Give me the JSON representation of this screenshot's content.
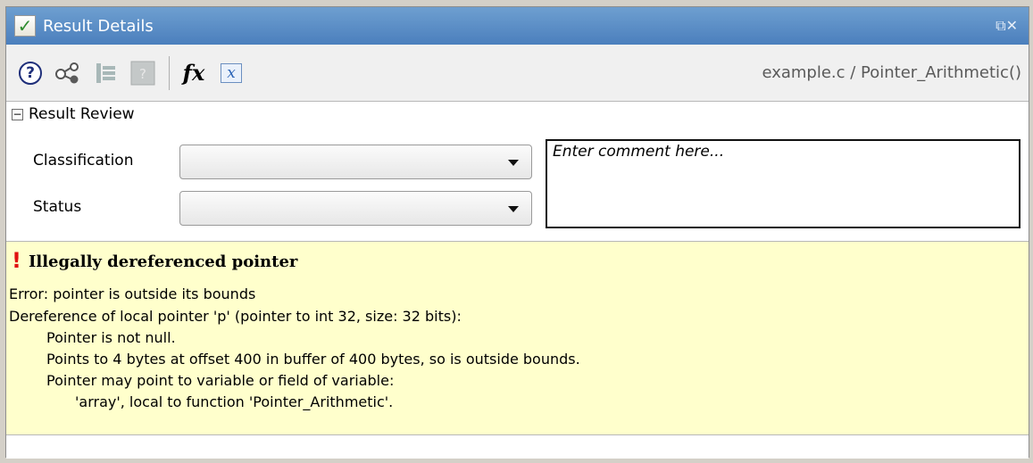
{
  "titlebar": {
    "title": "Result Details",
    "controls": "⧉✕"
  },
  "toolbar": {
    "fx_label": "fx",
    "x_label": "x",
    "breadcrumb": "example.c / Pointer_Arithmetic()"
  },
  "review": {
    "section_label": "Result Review",
    "collapse_glyph": "−",
    "classification_label": "Classification",
    "status_label": "Status",
    "classification_value": "",
    "status_value": "",
    "comment_placeholder": "Enter comment here..."
  },
  "result": {
    "bang": "!",
    "title": "Illegally dereferenced pointer",
    "lines": [
      "Error: pointer is outside its bounds",
      "Dereference of local pointer 'p' (pointer to int 32, size: 32 bits):",
      "Pointer is not null.",
      "Points to 4 bytes at offset 400 in buffer of 400 bytes, so is outside bounds.",
      "Pointer may point to variable or field of variable:",
      "'array', local to function 'Pointer_Arithmetic'."
    ]
  },
  "colors": {
    "titlebar": "#4b7fbd",
    "result_background": "#ffffcc",
    "error_mark": "#e01010"
  }
}
